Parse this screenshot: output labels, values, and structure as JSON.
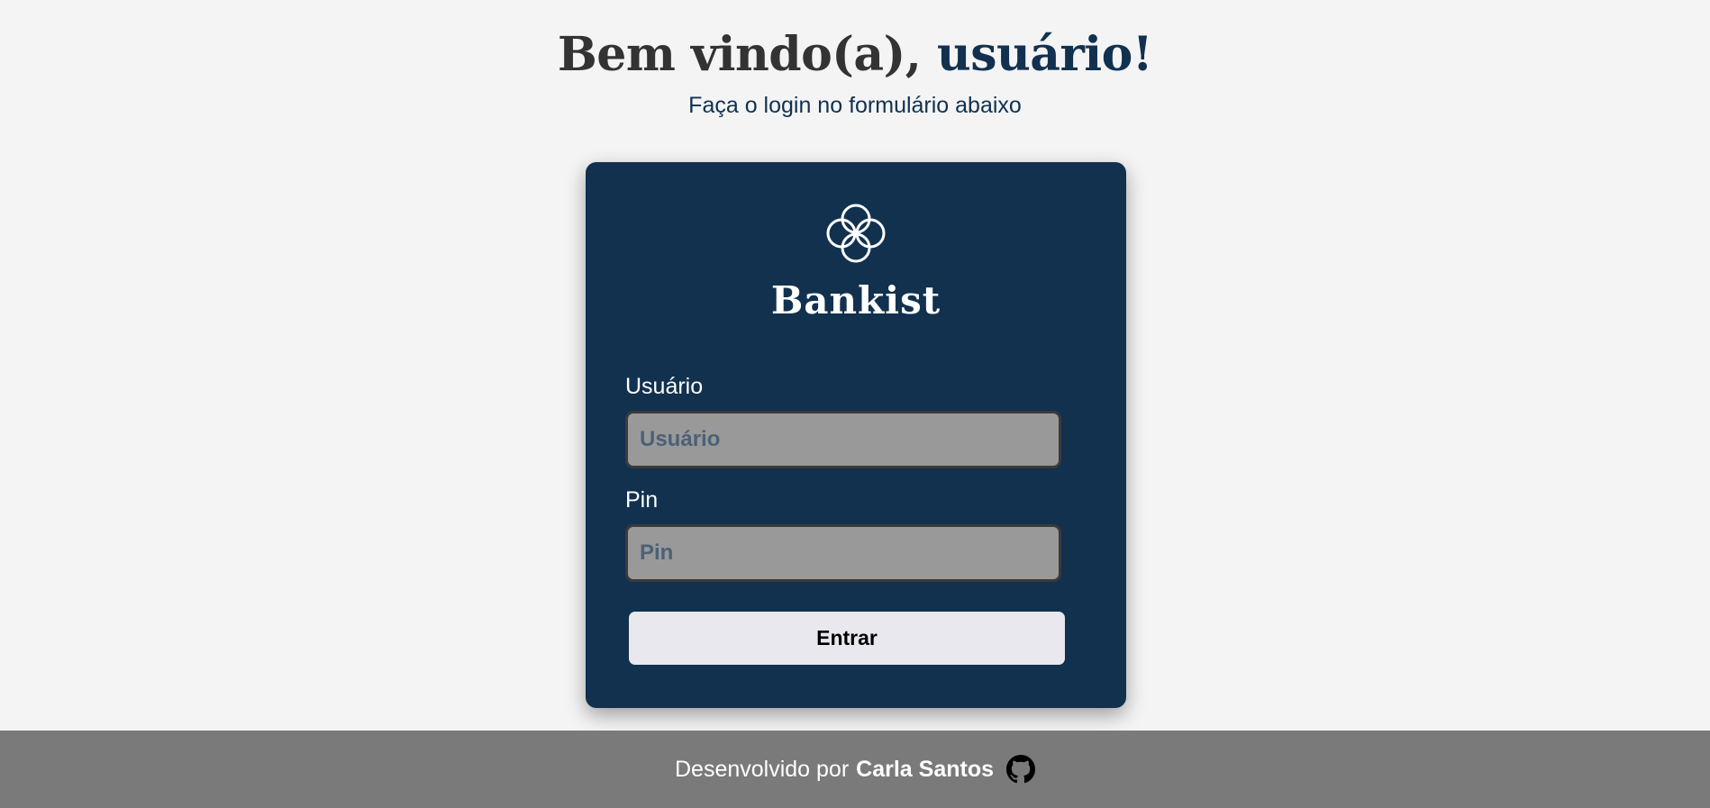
{
  "header": {
    "title_prefix": "Bem vindo(a), ",
    "title_highlight": "usuário!",
    "subtitle": "Faça o login no formulário abaixo"
  },
  "login_card": {
    "logo_icon": "interlocking-rings-icon",
    "brand": "Bankist",
    "username": {
      "label": "Usuário",
      "placeholder": "Usuário",
      "value": ""
    },
    "pin": {
      "label": "Pin",
      "placeholder": "Pin",
      "value": ""
    },
    "submit_label": "Entrar"
  },
  "footer": {
    "text": "Desenvolvido por",
    "author": "Carla Santos",
    "icon": "github-icon"
  },
  "colors": {
    "page_background": "#f4f4f4",
    "primary_navy": "#11314f",
    "heading_text": "#333333",
    "input_background": "#999999",
    "button_background": "#e8e8ee",
    "footer_background": "#7a7a7a"
  }
}
